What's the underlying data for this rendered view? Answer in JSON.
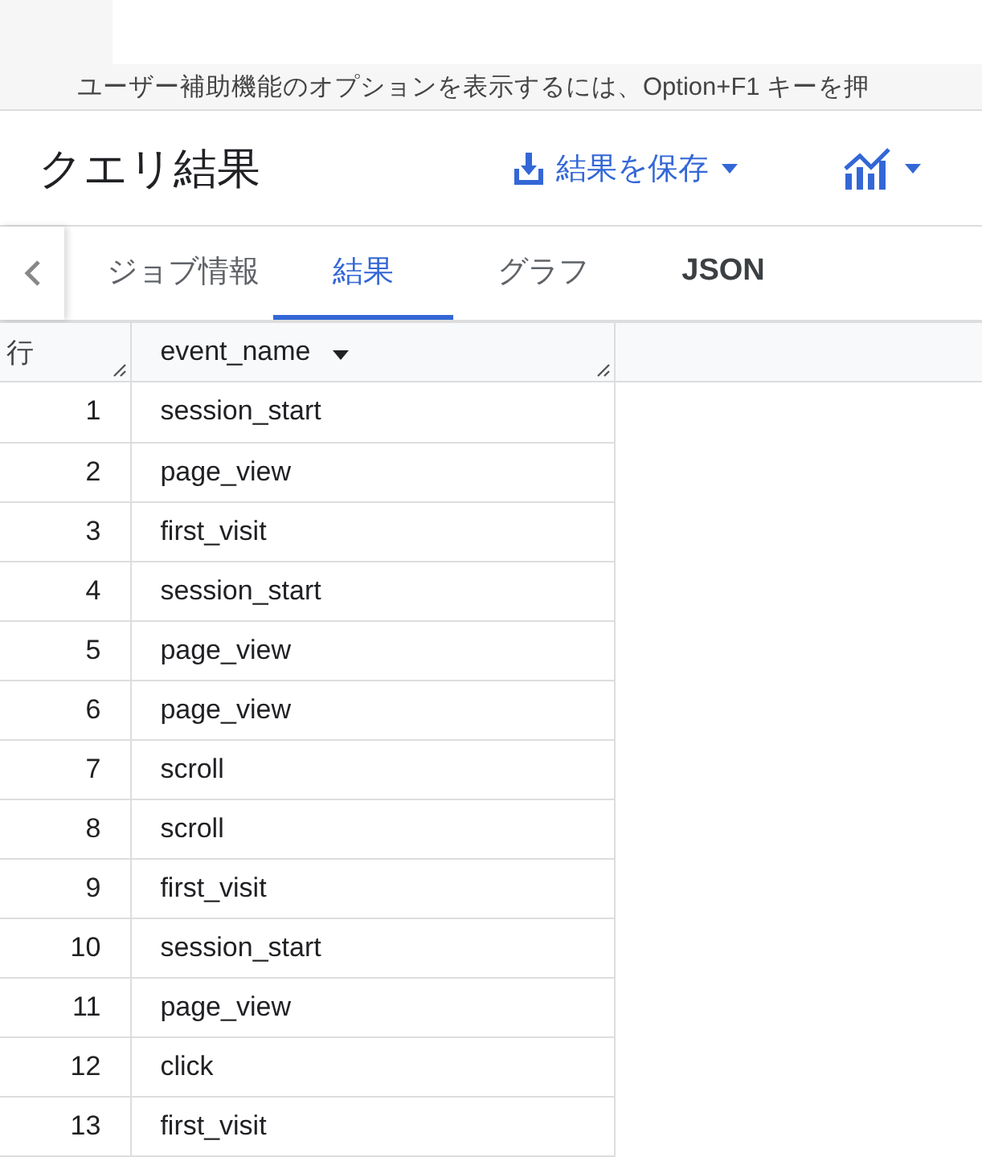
{
  "notice": "ユーザー補助機能のオプションを表示するには、Option+F1 キーを押",
  "title": "クエリ結果",
  "save_button": {
    "label": "結果を保存"
  },
  "tabs": [
    {
      "label": "ジョブ情報",
      "selected": false
    },
    {
      "label": "結果",
      "selected": true
    },
    {
      "label": "グラフ",
      "selected": false
    },
    {
      "label": "JSON",
      "selected": false
    }
  ],
  "table": {
    "columns": [
      "行",
      "event_name"
    ],
    "rows": [
      [
        "1",
        "session_start"
      ],
      [
        "2",
        "page_view"
      ],
      [
        "3",
        "first_visit"
      ],
      [
        "4",
        "session_start"
      ],
      [
        "5",
        "page_view"
      ],
      [
        "6",
        "page_view"
      ],
      [
        "7",
        "scroll"
      ],
      [
        "8",
        "scroll"
      ],
      [
        "9",
        "first_visit"
      ],
      [
        "10",
        "session_start"
      ],
      [
        "11",
        "page_view"
      ],
      [
        "12",
        "click"
      ],
      [
        "13",
        "first_visit"
      ]
    ]
  }
}
